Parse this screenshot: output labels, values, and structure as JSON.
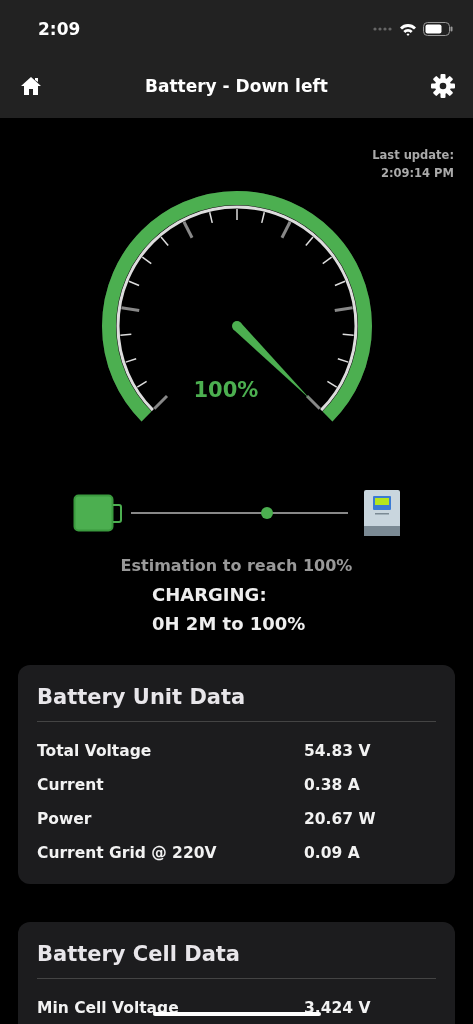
{
  "status_bar": {
    "time": "2:09"
  },
  "nav_bar": {
    "title": "Battery - Down left"
  },
  "last_update": {
    "label": "Last update:",
    "time": "2:09:14 PM"
  },
  "gauge": {
    "reading": "100%"
  },
  "estimation": {
    "label": "Estimation to reach 100%",
    "state": "CHARGING:",
    "remaining": "0H 2M to 100%"
  },
  "cards": [
    {
      "title": "Battery Unit Data",
      "rows": [
        {
          "label": "Total Voltage",
          "value": "54.83 V"
        },
        {
          "label": "Current",
          "value": "0.38 A"
        },
        {
          "label": "Power",
          "value": "20.67 W"
        },
        {
          "label": "Current Grid @ 220V",
          "value": "0.09 A"
        }
      ]
    },
    {
      "title": "Battery Cell Data",
      "rows": [
        {
          "label": "Min Cell Voltage",
          "value": "3.424 V"
        }
      ]
    }
  ]
}
